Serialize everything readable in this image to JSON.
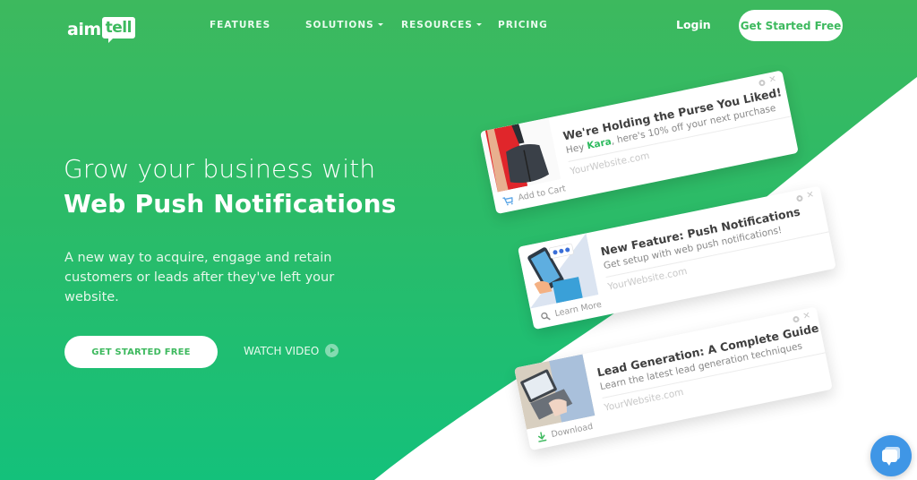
{
  "nav": {
    "logo_part1": "aim",
    "logo_part2": "tell",
    "links": [
      {
        "label": "FEATURES",
        "has_dropdown": false
      },
      {
        "label": "SOLUTIONS",
        "has_dropdown": true
      },
      {
        "label": "RESOURCES",
        "has_dropdown": true
      },
      {
        "label": "PRICING",
        "has_dropdown": false
      }
    ],
    "login": "Login",
    "cta": "Get Started Free"
  },
  "hero": {
    "headline_line1": "Grow your business with",
    "headline_line2": "Web Push Notifications",
    "subtext": "A new way to acquire, engage and retain customers or leads after they've left your website.",
    "primary_cta": "GET STARTED FREE",
    "secondary_cta": "WATCH VIDEO"
  },
  "notifications": [
    {
      "title": "We're Holding the Purse You Liked!",
      "message_prefix": "Hey ",
      "message_highlight": "Kara",
      "message_suffix": ", here's 10% off your next purchase",
      "site": "YourWebsite.com",
      "action": "Add to Cart",
      "action_icon": "cart-icon"
    },
    {
      "title": "New Feature: Push Notifications",
      "message_prefix": "Get setup with web push notifications!",
      "message_highlight": "",
      "message_suffix": "",
      "site": "YourWebsite.com",
      "action": "Learn More",
      "action_icon": "search-icon"
    },
    {
      "title": "Lead Generation: A Complete Guide",
      "message_prefix": "Learn the latest lead generation techniques",
      "message_highlight": "",
      "message_suffix": "",
      "site": "YourWebsite.com",
      "action": "Download",
      "action_icon": "download-icon"
    }
  ],
  "colors": {
    "brand_green": "#3db95e",
    "accent_green_bottom": "#14c17b",
    "chat_blue": "#3f96e6"
  }
}
